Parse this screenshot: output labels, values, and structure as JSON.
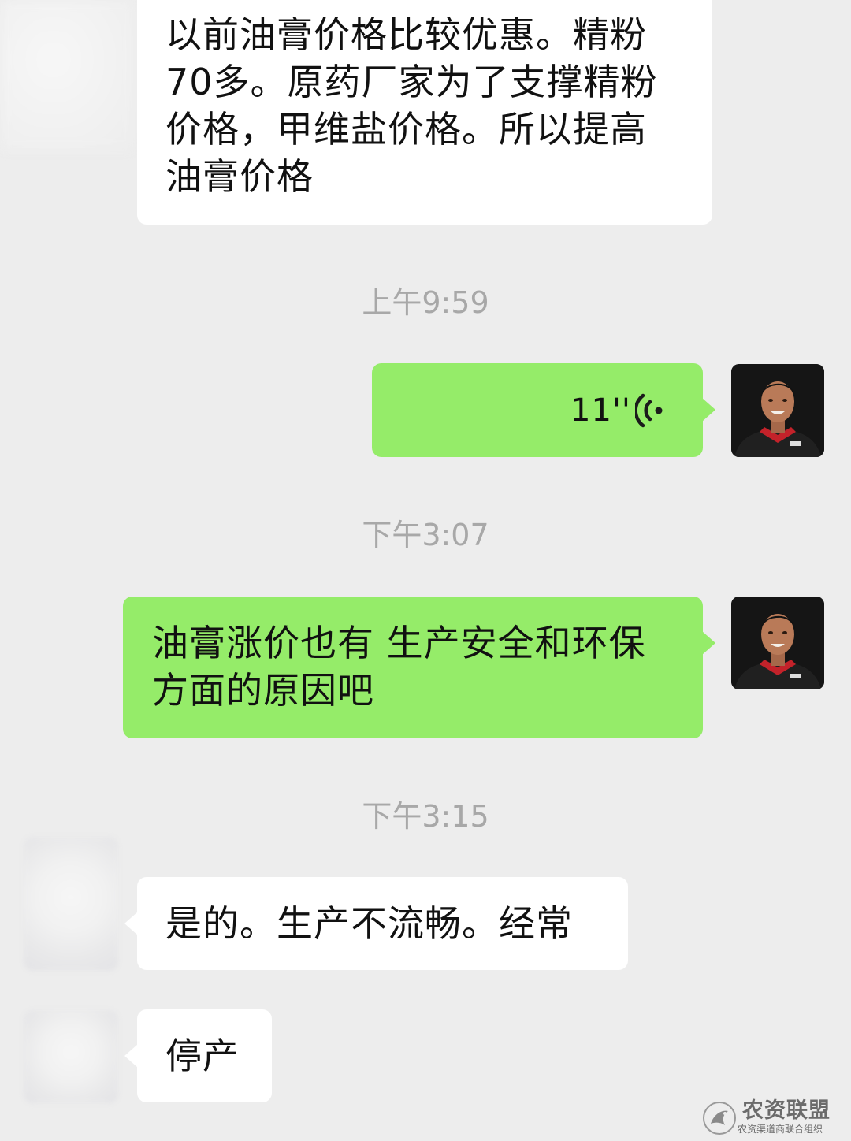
{
  "messages": [
    {
      "side": "left",
      "type": "text",
      "lines": [
        "以前油膏价格比较优惠。精粉",
        "70多。原药厂家为了支撑精粉",
        "价格，甲维盐价格。所以提高",
        "油膏价格"
      ]
    },
    {
      "type": "timestamp",
      "text": "上午9:59"
    },
    {
      "side": "right",
      "type": "voice",
      "duration": "11''"
    },
    {
      "type": "timestamp",
      "text": "下午3:07"
    },
    {
      "side": "right",
      "type": "text",
      "lines": [
        "油膏涨价也有 生产安全和环保",
        "方面的原因吧"
      ]
    },
    {
      "type": "timestamp",
      "text": "下午3:15"
    },
    {
      "side": "left",
      "type": "text",
      "lines": [
        "是的。生产不流畅。经常"
      ]
    },
    {
      "side": "left",
      "type": "text",
      "lines": [
        "停产"
      ]
    }
  ],
  "watermark": {
    "title": "农资联盟",
    "subtitle": "农资渠道商联合组织"
  },
  "colors": {
    "background": "#ededed",
    "left_bubble": "#ffffff",
    "right_bubble": "#95ec69",
    "timestamp": "#a8a8a8"
  },
  "icons": [
    "voice-wave-icon",
    "watermark-logo-icon"
  ]
}
